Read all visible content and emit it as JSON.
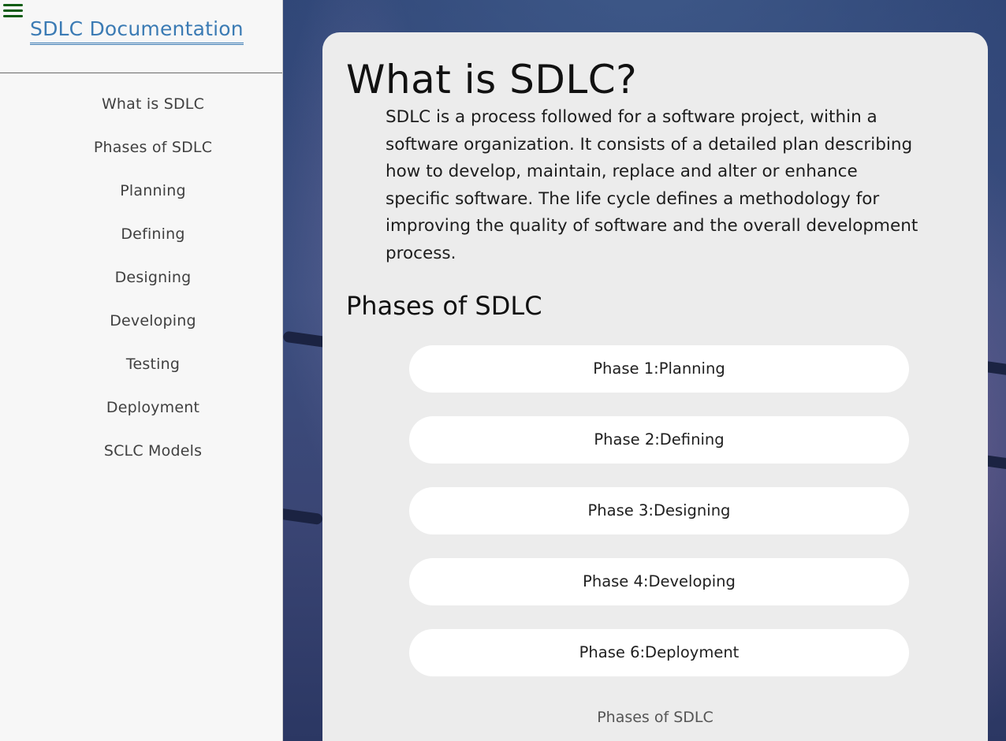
{
  "sidebar": {
    "brand": "SDLC Documentation",
    "items": [
      {
        "label": "What is SDLC"
      },
      {
        "label": "Phases of SDLC"
      },
      {
        "label": "Planning"
      },
      {
        "label": "Defining"
      },
      {
        "label": "Designing"
      },
      {
        "label": "Developing"
      },
      {
        "label": "Testing"
      },
      {
        "label": "Deployment"
      },
      {
        "label": "SCLC Models"
      }
    ]
  },
  "main": {
    "title": "What is SDLC?",
    "intro": "SDLC is a process followed for a software project, within a software organization. It consists of a detailed plan describing how to develop, maintain, replace and alter or enhance specific software. The life cycle defines a methodology for improving the quality of software and the overall development process.",
    "phases_heading": "Phases of SDLC",
    "phases": [
      {
        "label": "Phase 1:Planning"
      },
      {
        "label": "Phase 2:Defining"
      },
      {
        "label": "Phase 3:Designing"
      },
      {
        "label": "Phase 4:Developing"
      },
      {
        "label": "Phase 6:Deployment"
      }
    ],
    "footer_link": "Phases of SDLC"
  },
  "icons": {
    "menu": "hamburger-menu-icon"
  },
  "colors": {
    "brand_link": "#3b7bb4",
    "menu_icon": "#0d5c12",
    "sidebar_bg": "#f7f7f7",
    "card_bg": "#ececec"
  }
}
